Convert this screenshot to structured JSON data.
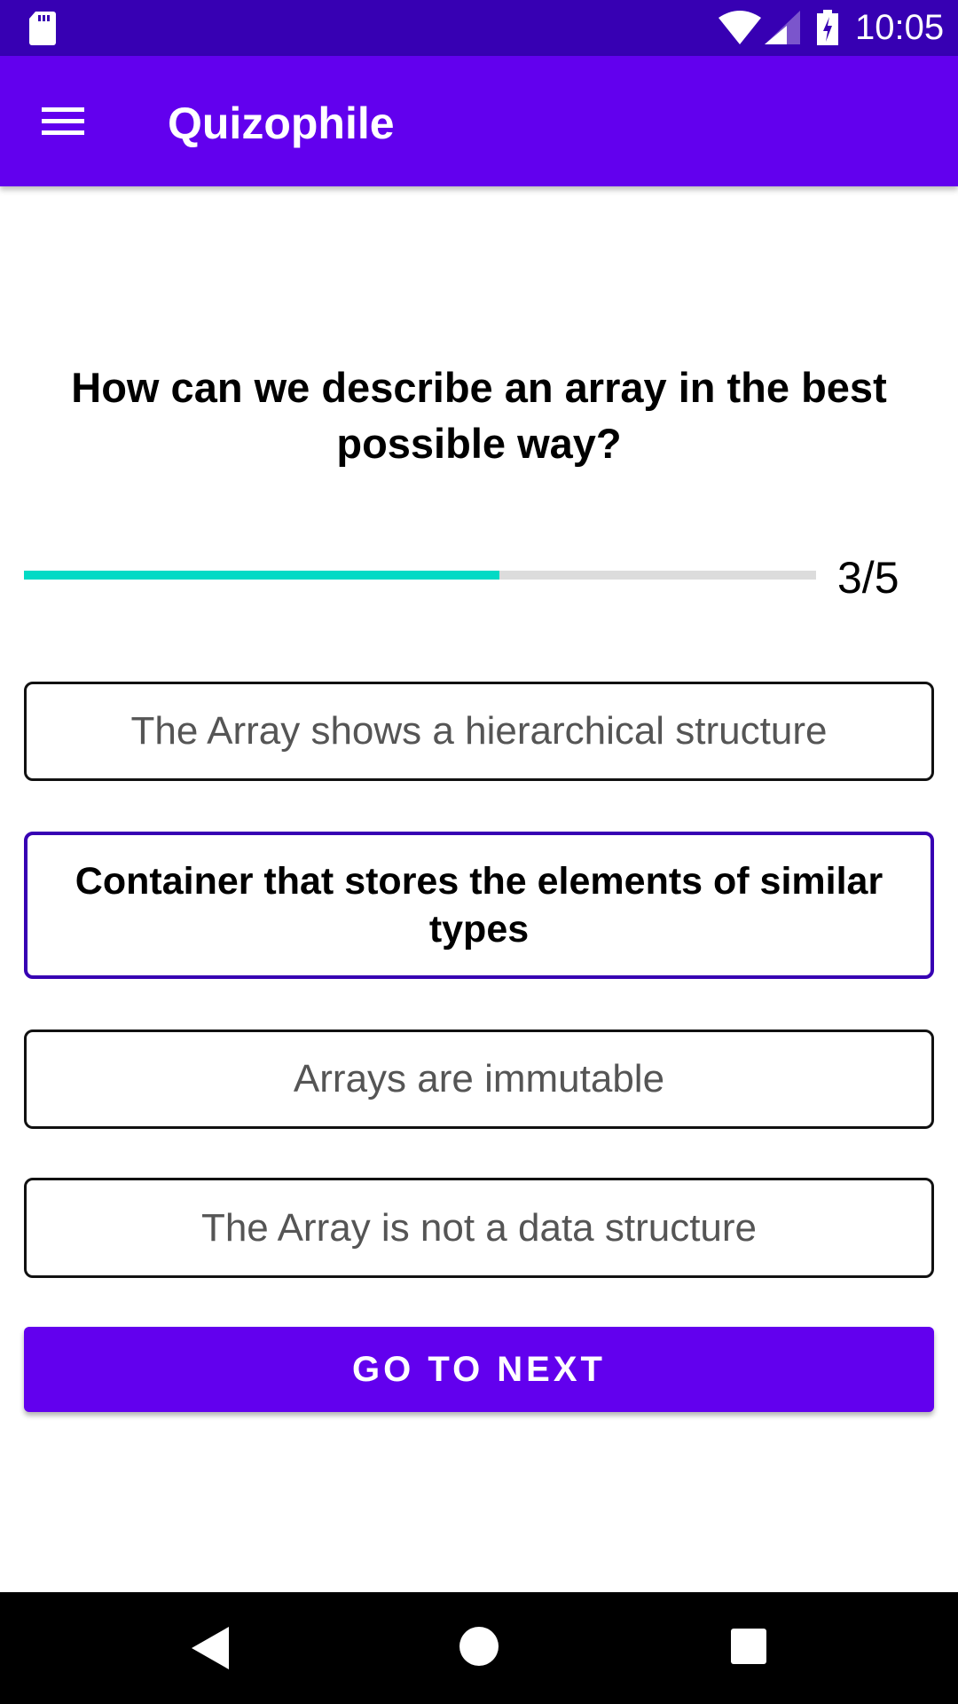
{
  "status_bar": {
    "time": "10:05",
    "icons": [
      "sd-card-icon",
      "wifi-icon",
      "signal-icon",
      "battery-charging-icon"
    ]
  },
  "app_bar": {
    "title": "Quizophile",
    "menu_icon": "hamburger-menu-icon"
  },
  "quiz": {
    "question": "How can we describe an array in the best possible way?",
    "progress": {
      "current": 3,
      "total": 5,
      "label": "3/5",
      "fill_fraction": 0.6
    },
    "options": [
      {
        "label": "The Array shows a hierarchical structure",
        "selected": false
      },
      {
        "label": "Container that stores the elements of similar types",
        "selected": true
      },
      {
        "label": "Arrays are immutable",
        "selected": false
      },
      {
        "label": "The Array is not a data structure",
        "selected": false
      }
    ],
    "next_button": "GO TO NEXT"
  },
  "colors": {
    "primary": "#6200EE",
    "primary_dark": "#3700B3",
    "accent": "#03DAC5"
  },
  "nav_bar": {
    "icons": [
      "back-icon",
      "home-icon",
      "recents-icon"
    ]
  }
}
